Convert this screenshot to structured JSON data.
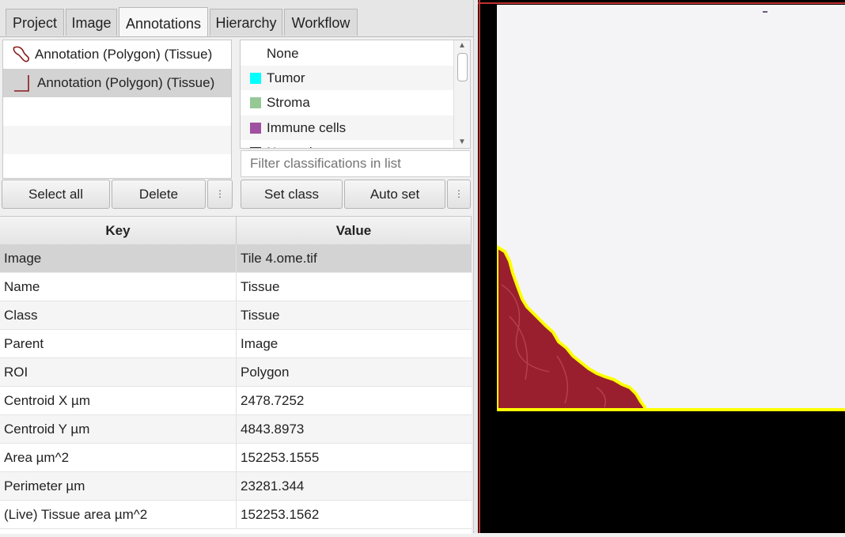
{
  "tabs": [
    "Project",
    "Image",
    "Annotations",
    "Hierarchy",
    "Workflow"
  ],
  "active_tab": "Annotations",
  "annotations": {
    "items": [
      {
        "label": "Annotation (Polygon) (Tissue)",
        "selected": false
      },
      {
        "label": "Annotation (Polygon) (Tissue)",
        "selected": true
      }
    ],
    "select_all_label": "Select all",
    "delete_label": "Delete",
    "more_label": "⋮"
  },
  "classifications": {
    "items": [
      {
        "label": "None",
        "color": ""
      },
      {
        "label": "Tumor",
        "color": "#00ffff"
      },
      {
        "label": "Stroma",
        "color": "#96c896"
      },
      {
        "label": "Immune cells",
        "color": "#a050a0"
      },
      {
        "label": "Necrosis",
        "color": "#323232"
      }
    ],
    "filter_placeholder": "Filter classifications in list",
    "set_class_label": "Set class",
    "auto_set_label": "Auto set",
    "more_label": "⋮"
  },
  "measurements": {
    "headers": {
      "key": "Key",
      "value": "Value"
    },
    "rows": [
      {
        "key": "Image",
        "value": "Tile 4.ome.tif"
      },
      {
        "key": "Name",
        "value": "Tissue"
      },
      {
        "key": "Class",
        "value": "Tissue"
      },
      {
        "key": "Parent",
        "value": "Image"
      },
      {
        "key": "ROI",
        "value": "Polygon"
      },
      {
        "key": "Centroid X µm",
        "value": "2478.7252"
      },
      {
        "key": "Centroid Y µm",
        "value": "4843.8973"
      },
      {
        "key": "Area µm^2",
        "value": "152253.1555"
      },
      {
        "key": "Perimeter µm",
        "value": "23281.344"
      },
      {
        "key": "(Live) Tissue area µm^2",
        "value": "152253.1562"
      }
    ]
  },
  "colors": {
    "annotation_outline": "#8b1a1a",
    "selected_outline": "#ffff00",
    "tissue": "#9a1f2e",
    "background_slide": "#f4f4f6"
  }
}
